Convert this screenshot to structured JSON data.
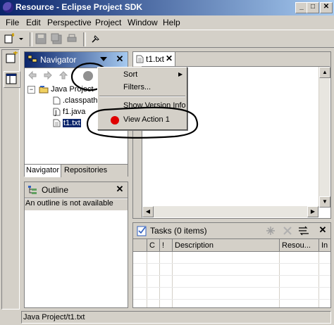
{
  "window": {
    "title": "Resource - Eclipse Project SDK",
    "controls": {
      "minimize": "_",
      "maximize": "□",
      "close": "✕"
    }
  },
  "menubar": {
    "items": [
      "File",
      "Edit",
      "Perspective",
      "Project",
      "Window",
      "Help"
    ]
  },
  "navigator": {
    "title": "Navigator",
    "tree": {
      "root": "Java Project",
      "children": [
        ".classpath",
        "f1.java",
        "t1.txt"
      ]
    },
    "tabs": [
      "Navigator",
      "Repositories"
    ]
  },
  "context_menu": {
    "items": [
      "Sort",
      "Filters...",
      "Show Version Info",
      "View Action 1"
    ]
  },
  "outline": {
    "title": "Outline",
    "message": "An outline is not available"
  },
  "editor": {
    "tab": "t1.txt"
  },
  "tasks": {
    "title": "Tasks (0 items)",
    "columns": [
      "",
      "C",
      "!",
      "Description",
      "Resou...",
      "In"
    ]
  },
  "statusbar": {
    "text": "Java Project/t1.txt"
  },
  "colors": {
    "title_start": "#0a246a",
    "title_end": "#a6caf0",
    "selection": "#0a246a",
    "action_dot": "#e00000"
  }
}
